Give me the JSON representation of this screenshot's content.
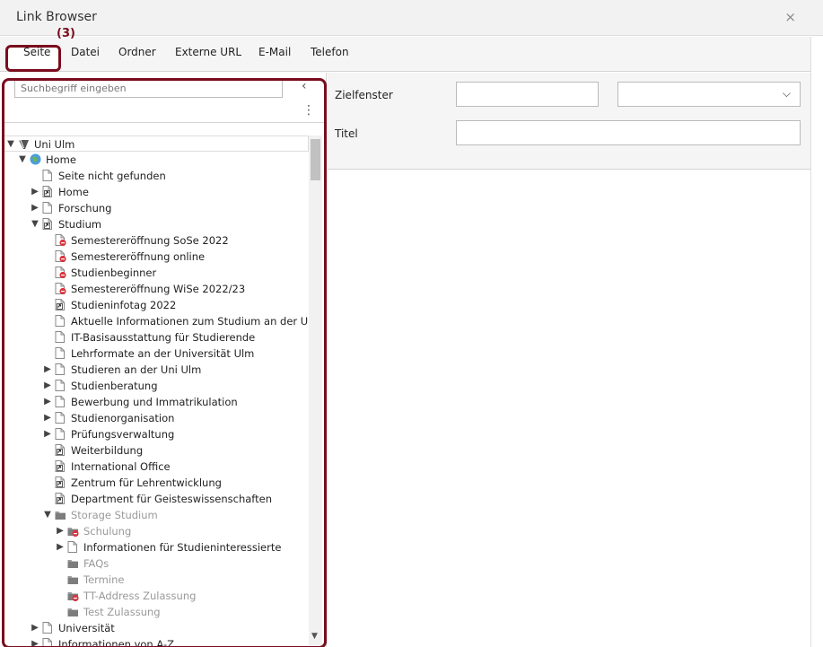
{
  "window": {
    "title": "Link Browser",
    "close_glyph": "×"
  },
  "annotation": "(3)",
  "tabs": [
    {
      "label": "Seite"
    },
    {
      "label": "Datei"
    },
    {
      "label": "Ordner"
    },
    {
      "label": "Externe URL"
    },
    {
      "label": "E-Mail"
    },
    {
      "label": "Telefon"
    }
  ],
  "search": {
    "placeholder": "Suchbegriff eingeben"
  },
  "form": {
    "target_label": "Zielfenster",
    "target_value": "",
    "target_select_value": "",
    "title_label": "Titel",
    "title_value": ""
  },
  "tree": [
    {
      "label": "Uni Ulm",
      "level": 0,
      "toggle": "open",
      "icon": "typo3-logo-icon",
      "muted": false
    },
    {
      "label": "Home",
      "level": 1,
      "toggle": "open",
      "icon": "globe-icon",
      "muted": false
    },
    {
      "label": "Seite nicht gefunden",
      "level": 2,
      "toggle": "none",
      "icon": "page-icon",
      "muted": false
    },
    {
      "label": "Home",
      "level": 2,
      "toggle": "closed",
      "icon": "shortcut-page-icon",
      "muted": false
    },
    {
      "label": "Forschung",
      "level": 2,
      "toggle": "closed",
      "icon": "page-icon",
      "muted": false
    },
    {
      "label": "Studium",
      "level": 2,
      "toggle": "open",
      "icon": "shortcut-page-icon",
      "muted": false
    },
    {
      "label": "Semestereröffnung SoSe 2022",
      "level": 3,
      "toggle": "none",
      "icon": "hidden-page-icon",
      "muted": false
    },
    {
      "label": "Semestereröffnung online",
      "level": 3,
      "toggle": "none",
      "icon": "hidden-page-icon",
      "muted": false
    },
    {
      "label": "Studienbeginner",
      "level": 3,
      "toggle": "none",
      "icon": "hidden-page-icon",
      "muted": false
    },
    {
      "label": "Semestereröffnung WiSe 2022/23",
      "level": 3,
      "toggle": "none",
      "icon": "hidden-page-icon",
      "muted": false
    },
    {
      "label": "Studieninfotag 2022",
      "level": 3,
      "toggle": "none",
      "icon": "shortcut-page-icon",
      "muted": false
    },
    {
      "label": "Aktuelle Informationen zum Studium an der Universität",
      "level": 3,
      "toggle": "none",
      "icon": "page-icon",
      "muted": false
    },
    {
      "label": "IT-Basisausstattung für Studierende",
      "level": 3,
      "toggle": "none",
      "icon": "page-icon",
      "muted": false
    },
    {
      "label": "Lehrformate an der Universität Ulm",
      "level": 3,
      "toggle": "none",
      "icon": "page-icon",
      "muted": false
    },
    {
      "label": "Studieren an der Uni Ulm",
      "level": 3,
      "toggle": "closed",
      "icon": "page-icon",
      "muted": false
    },
    {
      "label": "Studienberatung",
      "level": 3,
      "toggle": "closed",
      "icon": "page-icon",
      "muted": false
    },
    {
      "label": "Bewerbung und Immatrikulation",
      "level": 3,
      "toggle": "closed",
      "icon": "page-icon",
      "muted": false
    },
    {
      "label": "Studienorganisation",
      "level": 3,
      "toggle": "closed",
      "icon": "page-icon",
      "muted": false
    },
    {
      "label": "Prüfungsverwaltung",
      "level": 3,
      "toggle": "closed",
      "icon": "page-icon",
      "muted": false
    },
    {
      "label": "Weiterbildung",
      "level": 3,
      "toggle": "none",
      "icon": "shortcut-page-icon",
      "muted": false
    },
    {
      "label": "International Office",
      "level": 3,
      "toggle": "none",
      "icon": "shortcut-page-icon",
      "muted": false
    },
    {
      "label": "Zentrum für Lehrentwicklung",
      "level": 3,
      "toggle": "none",
      "icon": "shortcut-page-icon",
      "muted": false
    },
    {
      "label": "Department für Geisteswissenschaften",
      "level": 3,
      "toggle": "none",
      "icon": "shortcut-page-icon",
      "muted": false
    },
    {
      "label": "Storage Studium",
      "level": 3,
      "toggle": "open",
      "icon": "folder-icon",
      "muted": true
    },
    {
      "label": "Schulung",
      "level": 4,
      "toggle": "closed",
      "icon": "hidden-folder-icon",
      "muted": true
    },
    {
      "label": "Informationen für Studieninteressierte",
      "level": 4,
      "toggle": "closed",
      "icon": "page-icon",
      "muted": false
    },
    {
      "label": "FAQs",
      "level": 4,
      "toggle": "none",
      "icon": "folder-icon",
      "muted": true
    },
    {
      "label": "Termine",
      "level": 4,
      "toggle": "none",
      "icon": "folder-icon",
      "muted": true
    },
    {
      "label": "TT-Address Zulassung",
      "level": 4,
      "toggle": "none",
      "icon": "hidden-folder-icon",
      "muted": true
    },
    {
      "label": "Test Zulassung",
      "level": 4,
      "toggle": "none",
      "icon": "folder-icon",
      "muted": true
    },
    {
      "label": "Universität",
      "level": 2,
      "toggle": "closed",
      "icon": "page-icon",
      "muted": false
    },
    {
      "label": "Informationen von A-Z",
      "level": 2,
      "toggle": "closed",
      "icon": "page-icon",
      "muted": false
    }
  ],
  "colors": {
    "highlight": "#7a0c1e",
    "hidden_badge": "#d9363e",
    "globe": "#4a9de0"
  }
}
